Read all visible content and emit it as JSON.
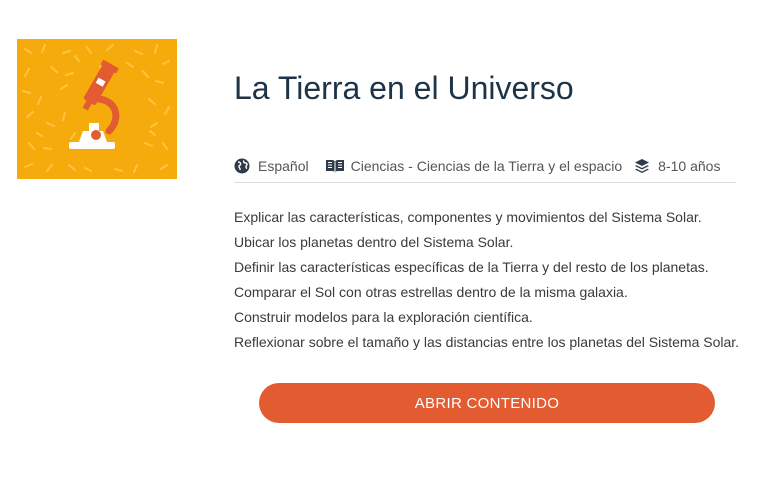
{
  "card": {
    "thumbnail_icon": "microscope-icon",
    "thumbnail_color": "#f6ab0c",
    "title": "La Tierra en el Universo",
    "meta": {
      "language_icon": "globe-icon",
      "language": "Español",
      "subject_icon": "open-book-icon",
      "subject": "Ciencias - Ciencias de la Tierra y el espacio",
      "level_icon": "layers-icon",
      "age_range": "8-10 años"
    },
    "objectives": [
      "Explicar las características, componentes y movimientos del Sistema Solar.",
      "Ubicar los planetas dentro del Sistema Solar.",
      "Definir las características específicas de la Tierra y del resto de los planetas.",
      "Comparar el Sol con otras estrellas dentro de la misma galaxia.",
      "Construir modelos para la exploración científica.",
      "Reflexionar sobre el tamaño y las distancias entre los planetas del Sistema Solar."
    ],
    "open_button_label": "ABRIR CONTENIDO",
    "accent_color": "#e35b31",
    "title_color": "#1d3347"
  }
}
